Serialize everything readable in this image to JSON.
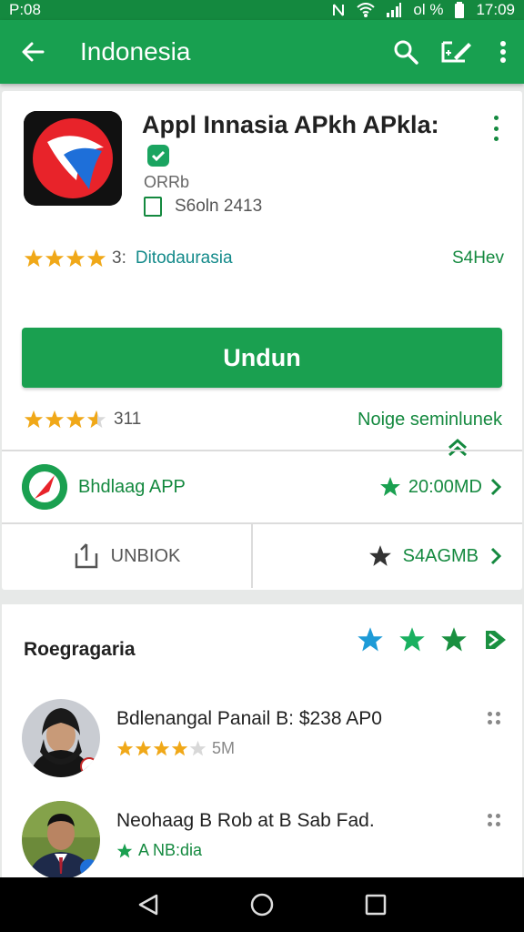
{
  "status_bar": {
    "time_left": "P:08",
    "signal_text": "ol %",
    "time_right": "17:09"
  },
  "app_bar": {
    "title": "Indonesia",
    "back_icon": "arrow-left-icon",
    "search_icon": "search-icon",
    "edit_icon": "edit-icon",
    "more_icon": "more-vert-icon"
  },
  "app": {
    "name": "Appl Innasia APkh APkla:",
    "developer": "ORRb",
    "meta": "S6oln 2413",
    "rating_count": "3:",
    "category": "Ditodaurasia",
    "size": "S4Hev",
    "install_label": "Undun",
    "rating_count_2": "311",
    "more_link": "Noige seminlunek"
  },
  "related": {
    "label": "Bhdlaag APP",
    "size": "20:00MD"
  },
  "actions": {
    "left_label": "UNBIOK",
    "right_label": "S4AGMB"
  },
  "section": {
    "title": "Roegragaria"
  },
  "reviews": [
    {
      "title": "Bdlenangal Panail B: $238 AP0",
      "sub": "5M"
    },
    {
      "title": "Neohaag B Rob at B Sab Fad.",
      "sub": "A NB:dia"
    }
  ],
  "colors": {
    "status_bar": "#14893f",
    "app_bar": "#18a050",
    "accent": "#14893f",
    "star_gold": "#f0a818",
    "teal_star": "#1e9bd7"
  }
}
